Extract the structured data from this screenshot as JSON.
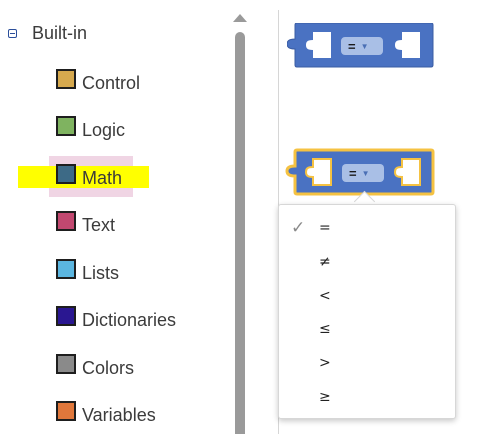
{
  "toolbox": {
    "root_label": "Built-in",
    "categories": [
      {
        "label": "Control",
        "color": "#d6a94e"
      },
      {
        "label": "Logic",
        "color": "#7fb360"
      },
      {
        "label": "Math",
        "color": "#3d6a86"
      },
      {
        "label": "Text",
        "color": "#c24870"
      },
      {
        "label": "Lists",
        "color": "#5bb6e0"
      },
      {
        "label": "Dictionaries",
        "color": "#2a1791"
      },
      {
        "label": "Colors",
        "color": "#8a8a8a"
      },
      {
        "label": "Variables",
        "color": "#e0773b"
      }
    ],
    "selected_category": "Math"
  },
  "workspace": {
    "block_color": "#4a72c2",
    "selected_outline_color": "#f5c242",
    "blocks": [
      {
        "operator": "=",
        "selected": false
      },
      {
        "operator": "=",
        "selected": true
      }
    ]
  },
  "dropdown_menu": {
    "items": [
      {
        "label": "=",
        "checked": true
      },
      {
        "label": "≠",
        "checked": false
      },
      {
        "label": "<",
        "checked": false
      },
      {
        "label": "≤",
        "checked": false
      },
      {
        "label": ">",
        "checked": false
      },
      {
        "label": "≥",
        "checked": false
      }
    ],
    "check_glyph": "✓"
  }
}
